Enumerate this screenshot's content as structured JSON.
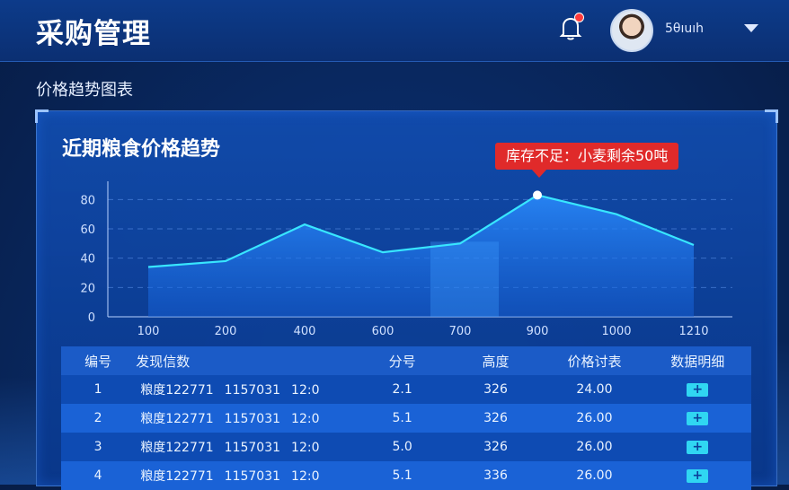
{
  "header": {
    "title": "采购管理",
    "username": "5θıuıh",
    "notification_dot": true
  },
  "section": {
    "title": "价格趋势图表"
  },
  "chart_card": {
    "title": "近期粮食价格趋势",
    "callout": "库存不足：小麦剩余50吨"
  },
  "chart_data": {
    "type": "area",
    "title": "近期粮食价格趋势",
    "xlabel": "",
    "ylabel": "",
    "x_ticks": [
      "100",
      "200",
      "400",
      "600",
      "700",
      "900",
      "1000",
      "1210"
    ],
    "y_ticks": [
      0,
      20,
      40,
      60,
      80
    ],
    "ylim": [
      0,
      90
    ],
    "grid": true,
    "series": [
      {
        "values": [
          34,
          38,
          63,
          44,
          50,
          83,
          70,
          49
        ]
      }
    ],
    "highlight_index": 5,
    "annotation": "库存不足：小麦剩余50吨",
    "colors": {
      "line": "#38e6ff",
      "fill": "#1e7ff0",
      "highlight_band": "#2a8cff"
    }
  },
  "table": {
    "headers": [
      "编号",
      "发现信数",
      "分号",
      "高度",
      "价格讨表",
      "数据明细"
    ],
    "rows": [
      {
        "id": "1",
        "name": "粮度122771",
        "code": "1157031",
        "time": "12:0",
        "sub": "2.1",
        "height": "326",
        "price": "24.00",
        "detail": "+"
      },
      {
        "id": "2",
        "name": "粮度122771",
        "code": "1157031",
        "time": "12:0",
        "sub": "5.1",
        "height": "326",
        "price": "26.00",
        "detail": "+"
      },
      {
        "id": "3",
        "name": "粮度122771",
        "code": "1157031",
        "time": "12:0",
        "sub": "5.0",
        "height": "326",
        "price": "26.00",
        "detail": "+"
      },
      {
        "id": "4",
        "name": "粮度122771",
        "code": "1157031",
        "time": "12:0",
        "sub": "5.1",
        "height": "336",
        "price": "26.00",
        "detail": "+"
      }
    ]
  },
  "colors": {
    "accent": "#30d6f2",
    "alert": "#e02a2a",
    "header_bg": "#0d3b8a"
  },
  "icons": {
    "bell": "bell-icon",
    "dropdown": "chevron-down-icon",
    "detail": "plus-icon"
  }
}
